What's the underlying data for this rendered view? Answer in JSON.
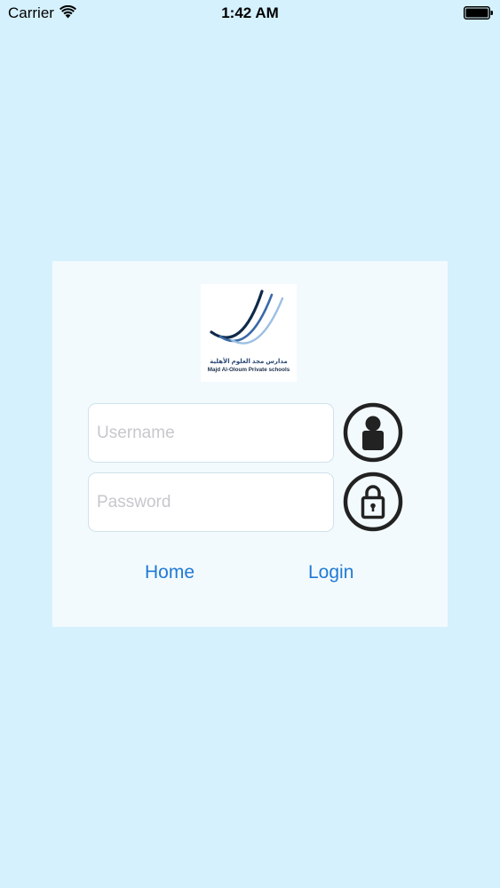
{
  "status_bar": {
    "carrier": "Carrier",
    "time": "1:42 AM",
    "wifi_icon": "wifi-icon",
    "battery_icon": "battery-full-icon"
  },
  "logo": {
    "arabic_text": "مدارس مجد العلوم الأهلية",
    "english_text": "Majd Al-Oloum Private schools",
    "colors": [
      "#0f2a4a",
      "#3a6aa8",
      "#9cc0e4"
    ]
  },
  "form": {
    "username_placeholder": "Username",
    "username_value": "",
    "username_icon": "user-icon",
    "password_placeholder": "Password",
    "password_value": "",
    "password_icon": "lock-icon"
  },
  "actions": {
    "home_label": "Home",
    "login_label": "Login"
  },
  "colors": {
    "background": "#d5f1fd",
    "card": "#f3fafe",
    "link": "#1f7ad4",
    "icon": "#222222"
  }
}
